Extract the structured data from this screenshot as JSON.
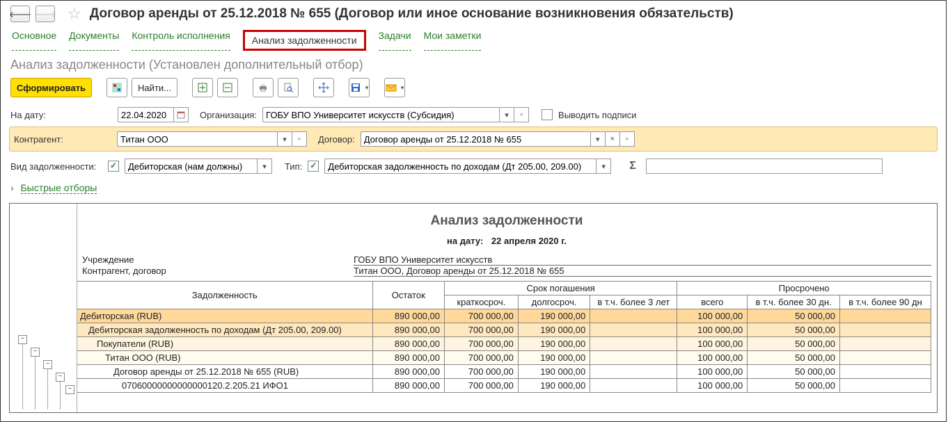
{
  "header": {
    "title": "Договор аренды от 25.12.2018 № 655 (Договор или иное основание возникновения обязательств)"
  },
  "tabs": {
    "main": "Основное",
    "docs": "Документы",
    "control": "Контроль исполнения",
    "analysis": "Анализ задолженности",
    "tasks": "Задачи",
    "notes": "Мои заметки"
  },
  "subtitle": "Анализ задолженности (Установлен дополнительный отбор)",
  "toolbar": {
    "run_label": "Сформировать",
    "find_label": "Найти..."
  },
  "filters": {
    "date_label": "На дату:",
    "date_value": "22.04.2020",
    "org_label": "Организация:",
    "org_value": "ГОБУ ВПО Университет искусств (Субсидия)",
    "sign_label": "Выводить подписи",
    "contr_label": "Контрагент:",
    "contr_value": "Титан ООО",
    "contract_label": "Договор:",
    "contract_value": "Договор аренды от 25.12.2018 № 655",
    "debt_kind_label": "Вид задолженности:",
    "debt_kind_value": "Дебиторская (нам должны)",
    "type_label": "Тип:",
    "type_value": "Дебиторская задолженность по доходам (Дт 205.00, 209.00)",
    "quick_label": "Быстрые отборы"
  },
  "report": {
    "title": "Анализ задолженности",
    "date_label": "на дату:",
    "date_value": "22 апреля 2020 г.",
    "meta_org_label": "Учреждение",
    "meta_org_val": "ГОБУ ВПО Университет искусств",
    "meta_contr_label": "Контрагент, договор",
    "meta_contr_val": "Титан ООО, Договор аренды от 25.12.2018 № 655"
  },
  "columns": {
    "name": "Задолженность",
    "balance": "Остаток",
    "repay": "Срок погашения",
    "short": "краткосроч.",
    "long": "долгосроч.",
    "over3": "в т.ч. более 3 лет",
    "overdue": "Просрочено",
    "total": "всего",
    "over30": "в т.ч. более 30 дн.",
    "over90": "в т.ч. более 90 дн"
  },
  "rows": [
    {
      "lvl": 0,
      "ind": 0,
      "name": "Дебиторская (RUB)",
      "bal": "890 000,00",
      "short": "700 000,00",
      "long": "190 000,00",
      "o3": "",
      "tot": "100 000,00",
      "o30": "50 000,00",
      "o90": ""
    },
    {
      "lvl": 1,
      "ind": 1,
      "name": "Дебиторская задолженность по доходам (Дт 205.00, 209.00)",
      "bal": "890 000,00",
      "short": "700 000,00",
      "long": "190 000,00",
      "o3": "",
      "tot": "100 000,00",
      "o30": "50 000,00",
      "o90": ""
    },
    {
      "lvl": 2,
      "ind": 2,
      "name": "Покупатели (RUB)",
      "bal": "890 000,00",
      "short": "700 000,00",
      "long": "190 000,00",
      "o3": "",
      "tot": "100 000,00",
      "o30": "50 000,00",
      "o90": ""
    },
    {
      "lvl": 3,
      "ind": 3,
      "name": "Титан ООО (RUB)",
      "bal": "890 000,00",
      "short": "700 000,00",
      "long": "190 000,00",
      "o3": "",
      "tot": "100 000,00",
      "o30": "50 000,00",
      "o90": ""
    },
    {
      "lvl": 4,
      "ind": 4,
      "name": "Договор аренды от 25.12.2018 № 655 (RUB)",
      "bal": "890 000,00",
      "short": "700 000,00",
      "long": "190 000,00",
      "o3": "",
      "tot": "100 000,00",
      "o30": "50 000,00",
      "o90": ""
    },
    {
      "lvl": 5,
      "ind": 5,
      "name": "07060000000000000120.2.205.21 ИФО1",
      "bal": "890 000,00",
      "short": "700 000,00",
      "long": "190 000,00",
      "o3": "",
      "tot": "100 000,00",
      "o30": "50 000,00",
      "o90": ""
    }
  ]
}
